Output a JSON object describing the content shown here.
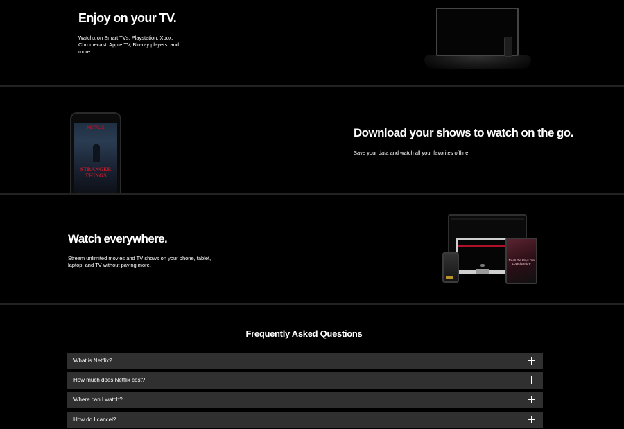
{
  "tv_section": {
    "title": "Enjoy on your TV.",
    "description": "Watchx on Smart TVs, Playstation, Xbox, Chromecast, Apple TV, Blu-ray players, and more."
  },
  "download_section": {
    "title": "Download your shows to watch on the go.",
    "description": "Save your data and watch all your favorites offline.",
    "phone_poster": {
      "logo": "NETFLIX",
      "title_line1": "STRANGER",
      "title_line2": "THINGS"
    }
  },
  "everywhere_section": {
    "title": "Watch everywhere.",
    "description": "Stream unlimited movies and TV shows on your phone, tablet, laptop, and TV without paying more.",
    "tablet_text": "To All the Boys I've Loved Before"
  },
  "faq": {
    "title": "Frequently Asked Questions",
    "items": [
      {
        "question": "What is Netflix?"
      },
      {
        "question": "How much does Netflix cost?"
      },
      {
        "question": "Where can I watch?"
      },
      {
        "question": "How do I cancel?"
      }
    ]
  },
  "colors": {
    "background": "#000000",
    "divider": "#222222",
    "faq_item_bg": "#303030",
    "brand_red": "#b0102a"
  },
  "icons": [
    "tv-icon",
    "remote-icon",
    "phone-icon",
    "laptop-icon",
    "imac-icon",
    "tablet-icon",
    "plus-icon"
  ]
}
